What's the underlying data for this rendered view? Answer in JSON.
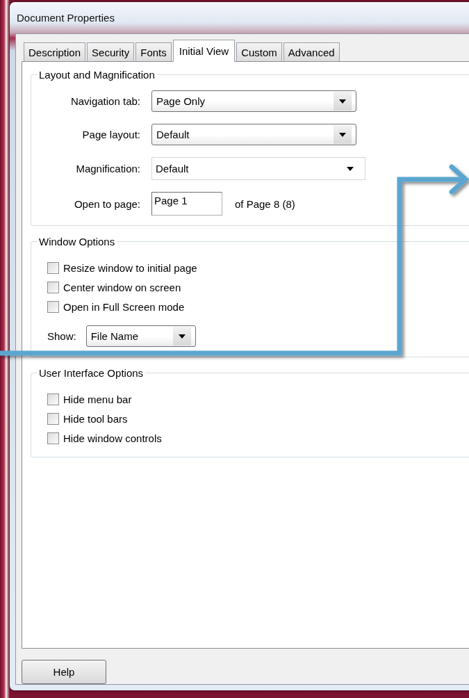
{
  "window": {
    "title": "Document Properties"
  },
  "tabs": [
    {
      "label": "Description",
      "selected": false
    },
    {
      "label": "Security",
      "selected": false
    },
    {
      "label": "Fonts",
      "selected": false
    },
    {
      "label": "Initial View",
      "selected": true
    },
    {
      "label": "Custom",
      "selected": false
    },
    {
      "label": "Advanced",
      "selected": false
    }
  ],
  "layout_and_magnification": {
    "title": "Layout and Magnification",
    "fields": [
      {
        "kind": "dropdown",
        "label": "Navigation tab:",
        "value": "Page Only"
      },
      {
        "kind": "dropdown",
        "label": "Page layout:",
        "value": "Default"
      },
      {
        "kind": "combo",
        "label": "Magnification:",
        "value": "Default"
      },
      {
        "kind": "text",
        "label": "Open to page:",
        "value": "Page 1",
        "suffix": "of Page 8 (8)"
      }
    ]
  },
  "window_options": {
    "title": "Window Options",
    "checkboxes": [
      {
        "label": "Resize window to initial page",
        "checked": false
      },
      {
        "label": "Center window on screen",
        "checked": false
      },
      {
        "label": "Open in Full Screen mode",
        "checked": false
      }
    ],
    "show": {
      "label": "Show:",
      "value": "File Name"
    }
  },
  "user_interface_options": {
    "title": "User Interface Options",
    "checkboxes": [
      {
        "label": "Hide menu bar",
        "checked": false
      },
      {
        "label": "Hide tool bars",
        "checked": false
      },
      {
        "label": "Hide window controls",
        "checked": false
      }
    ]
  },
  "buttons": [
    "Help"
  ]
}
